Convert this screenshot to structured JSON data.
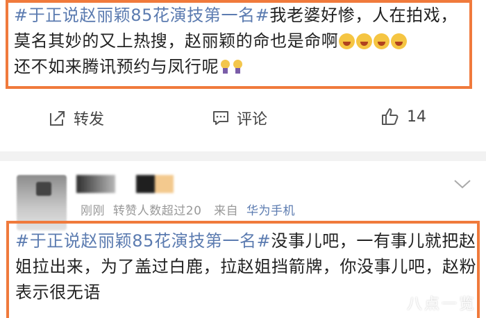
{
  "post1": {
    "hashtag": "#于正说赵丽颖85花演技第一名#",
    "text_a": "我老婆好惨，人在拍戏，莫名其妙的又上热搜，赵丽颖的命也是命啊",
    "text_b": "还不如来腾讯预约与凤行呢",
    "emojis": [
      "crying-face-icon",
      "crying-face-icon",
      "crying-face-icon",
      "crying-face-icon"
    ],
    "tail_emojis": [
      "lightbulb-icon",
      "lightbulb-icon"
    ]
  },
  "actions": {
    "repost_label": "转发",
    "comment_label": "评论",
    "like_count": "14"
  },
  "post2": {
    "meta_time": "刚刚",
    "meta_reposts": "转赞人数超过20",
    "meta_from": "来自",
    "meta_source": "华为手机",
    "hashtag": "#于正说赵丽颖85花演技第一名#",
    "text": "没事儿吧，一有事儿就把赵姐拉出来，为了盖过白鹿，拉赵姐挡箭牌，你没事儿吧，赵粉表示很无语"
  },
  "watermark": "八点一览",
  "colors": {
    "highlight_border": "#f07a3c",
    "hashtag": "#5b7bb0",
    "text": "#222222",
    "meta": "#999999"
  }
}
